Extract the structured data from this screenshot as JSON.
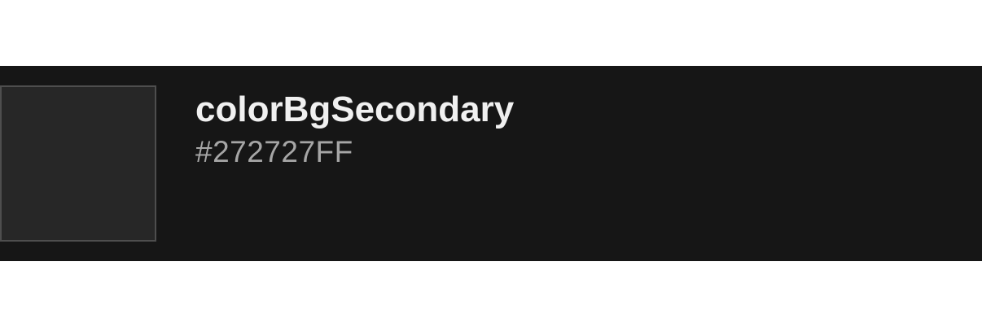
{
  "token": {
    "name": "colorBgSecondary",
    "value": "#272727FF",
    "swatch_color": "#272727",
    "card_background": "#161616"
  }
}
